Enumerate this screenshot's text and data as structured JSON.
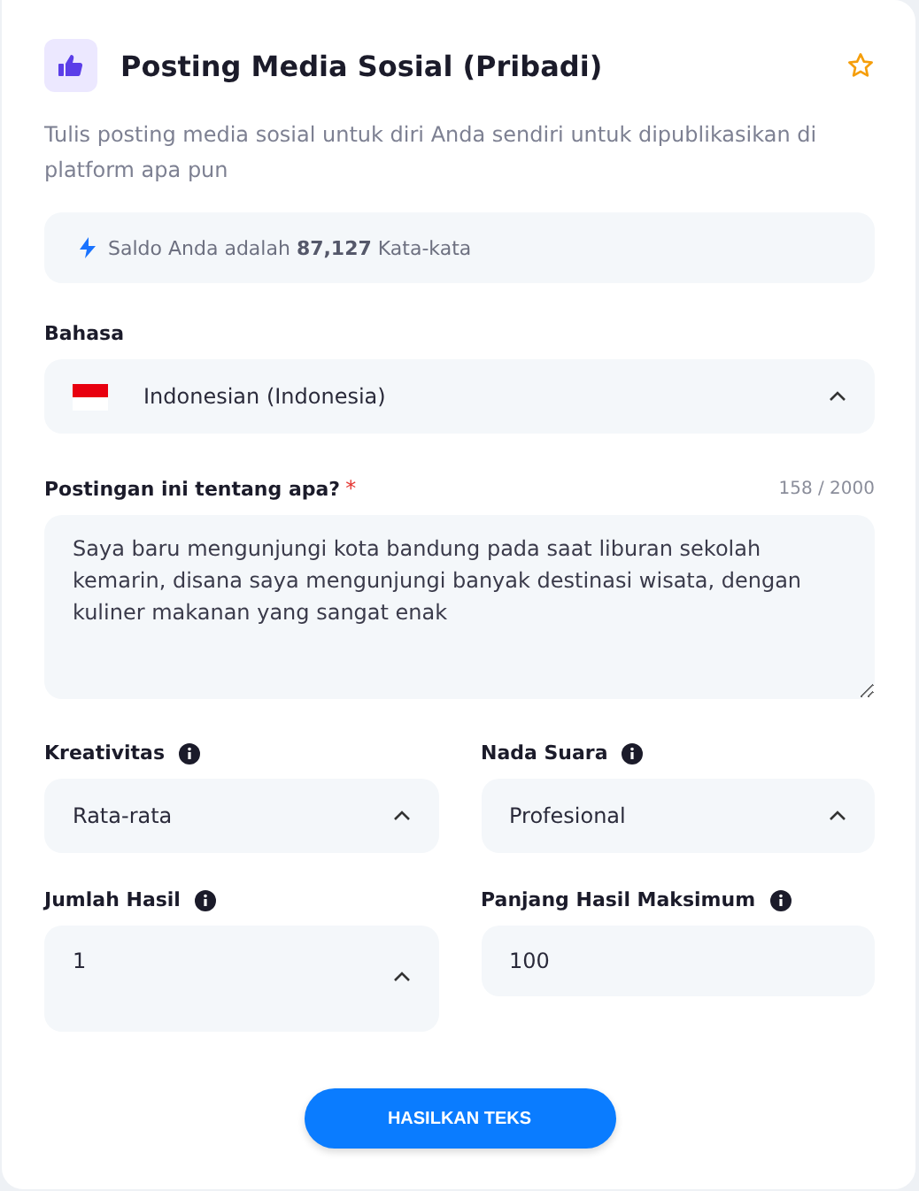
{
  "title": "Posting Media Sosial (Pribadi)",
  "description": "Tulis posting media sosial untuk diri Anda sendiri untuk dipublikasikan di platform apa pun",
  "balance": "Saldo Anda adalah **87,127** Kata-kata",
  "language": {
    "label": "Bahasa",
    "value": "Indonesian (Indonesia)"
  },
  "topic": {
    "label": "Postingan ini tentang apa?",
    "required_mark": "*",
    "counter": "158 / 2000",
    "value": "Saya baru mengunjungi kota bandung pada saat liburan sekolah kemarin, disana saya mengunjungi banyak destinasi wisata, dengan kuliner makanan yang sangat enak"
  },
  "options": [
    {
      "label": "Kreativitas",
      "kind": "select",
      "value": "Rata-rata"
    },
    {
      "label": "Nada Suara",
      "kind": "select",
      "value": "Profesional"
    },
    {
      "label": "Jumlah Hasil",
      "kind": "select",
      "value": "1"
    },
    {
      "label": "Panjang Hasil Maksimum",
      "kind": "input",
      "value": "100"
    }
  ],
  "submit": "HASILKAN TEKS"
}
